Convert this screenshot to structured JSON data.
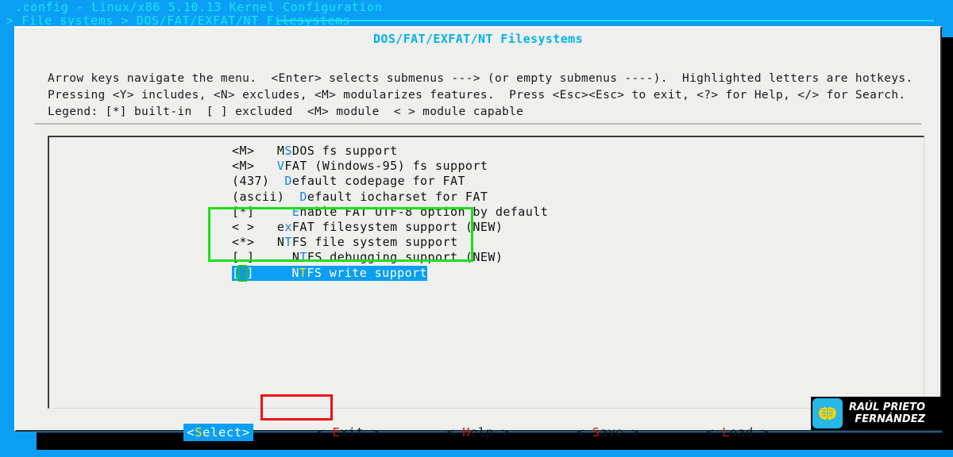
{
  "header": {
    "title": ".config - Linux/x86 5.10.13 Kernel Configuration",
    "breadcrumb": "> File systems > DOS/FAT/EXFAT/NT Filesystems"
  },
  "dialog": {
    "title": "DOS/FAT/EXFAT/NT Filesystems",
    "help": "Arrow keys navigate the menu.  <Enter> selects submenus ---> (or empty submenus ----).  Highlighted letters are hotkeys.  Pressing <Y> includes, <N> excludes, <M> modularizes features.  Press <Esc><Esc> to exit, <?> for Help, </> for Search.  Legend: [*] built-in  [ ] excluded  <M> module  < > module capable"
  },
  "menu": {
    "items": [
      {
        "state": "<M>",
        "indent": "  ",
        "pre": "MS",
        "hot": "",
        "label": "MSDOS fs support",
        "hot_index": 1,
        "new": false,
        "selected": false
      },
      {
        "state": "<M>",
        "indent": "  ",
        "label": "VFAT (Windows-95) fs support",
        "hot_index": 0,
        "new": false,
        "selected": false
      },
      {
        "state": "(437)",
        "indent": " ",
        "label": "Default codepage for FAT",
        "hot_index": 0,
        "new": false,
        "selected": false
      },
      {
        "state": "(ascii)",
        "indent": " ",
        "label": "Default iocharset for FAT",
        "hot_index": 0,
        "new": false,
        "selected": false
      },
      {
        "state": "[*]",
        "indent": "    ",
        "label": "Enable FAT UTF-8 option by default",
        "hot_index": 0,
        "new": false,
        "selected": false
      },
      {
        "state": "< >",
        "indent": "  ",
        "label": "exFAT filesystem support (NEW)",
        "hot_index": 1,
        "new": true,
        "selected": false
      },
      {
        "state": "<*>",
        "indent": "  ",
        "label": "NTFS file system support",
        "hot_index": 1,
        "new": false,
        "selected": false
      },
      {
        "state": "[ ]",
        "indent": "    ",
        "label": "NTFS debugging support (NEW)",
        "hot_index": 1,
        "new": true,
        "selected": false
      },
      {
        "state": "[ ]",
        "indent": "    ",
        "label": "NTFS write support",
        "hot_index": 1,
        "new": false,
        "selected": true
      }
    ],
    "rows_text": [
      "<M> MSDOS fs support",
      "<M> VFAT (Windows-95) fs support",
      "(437) Default codepage for FAT",
      "(ascii) Default iocharset for FAT",
      "[*]   Enable FAT UTF-8 option by default",
      "< > exFAT filesystem support (NEW)",
      "<*> NTFS file system support",
      "[ ]   NTFS debugging support (NEW)",
      "[ ]   NTFS write support"
    ]
  },
  "buttons": [
    {
      "label_pre": "<",
      "hot": "S",
      "label_post": "elect>",
      "selected": true,
      "name": "select"
    },
    {
      "label_pre": "< ",
      "hot": "E",
      "label_post": "xit >",
      "selected": false,
      "name": "exit"
    },
    {
      "label_pre": "< ",
      "hot": "H",
      "label_post": "elp >",
      "selected": false,
      "name": "help"
    },
    {
      "label_pre": "< ",
      "hot": "S",
      "label_post": "ave >",
      "selected": false,
      "name": "save"
    },
    {
      "label_pre": "< ",
      "hot": "L",
      "label_post": "oad >",
      "selected": false,
      "name": "load"
    }
  ],
  "annotations": {
    "green_box": "highlight around NTFS option group",
    "red_box": "highlight around Select button"
  },
  "watermark": {
    "line1": "RAÚL PRIETO",
    "line2": "FERNÁNDEZ",
    "logo": "brain-circuit-icon"
  },
  "colors": {
    "desktop_blue": "#0a9ff5",
    "header_cyan": "#19e6f5",
    "title_cyan": "#00b2ee",
    "hotkey_blue": "#1a7fe8",
    "selection_blue": "#0a9ff5",
    "hotkey_yellow": "#ffe600",
    "button_hotkey_red": "#cc1212",
    "anno_green": "#18e018",
    "anno_red": "#ee1111",
    "dialog_bg": "#efefed"
  }
}
